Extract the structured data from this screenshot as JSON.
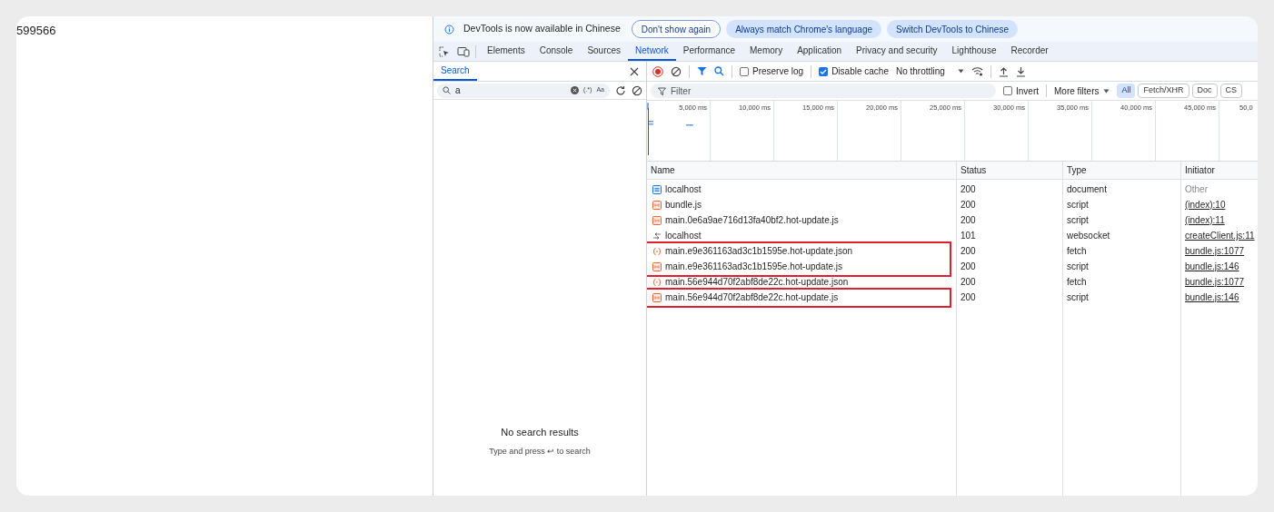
{
  "page_text": "599566",
  "banner": {
    "message": "DevTools is now available in Chinese",
    "buttons": [
      {
        "label": "Don't show again",
        "kind": "outline"
      },
      {
        "label": "Always match Chrome's language",
        "kind": "filled"
      },
      {
        "label": "Switch DevTools to Chinese",
        "kind": "filled"
      }
    ]
  },
  "tabs": [
    {
      "label": "Elements",
      "selected": false
    },
    {
      "label": "Console",
      "selected": false
    },
    {
      "label": "Sources",
      "selected": false
    },
    {
      "label": "Network",
      "selected": true
    },
    {
      "label": "Performance",
      "selected": false
    },
    {
      "label": "Memory",
      "selected": false
    },
    {
      "label": "Application",
      "selected": false
    },
    {
      "label": "Privacy and security",
      "selected": false
    },
    {
      "label": "Lighthouse",
      "selected": false
    },
    {
      "label": "Recorder",
      "selected": false
    }
  ],
  "search_panel": {
    "tab": "Search",
    "query": "a",
    "regex_label": "(.*)",
    "case_label": "Aa",
    "empty_title": "No search results",
    "empty_hint": "Type and press ↩ to search"
  },
  "toolbar": {
    "preserve_log": {
      "label": "Preserve log",
      "checked": false
    },
    "disable_cache": {
      "label": "Disable cache",
      "checked": true
    },
    "throttling": "No throttling"
  },
  "filter_bar": {
    "placeholder": "Filter",
    "invert": {
      "label": "Invert",
      "checked": false
    },
    "more_filters": "More filters",
    "chips": [
      {
        "label": "All",
        "selected": true
      },
      {
        "label": "Fetch/XHR",
        "selected": false
      },
      {
        "label": "Doc",
        "selected": false
      },
      {
        "label": "CS",
        "selected": false
      }
    ]
  },
  "timeline": {
    "ticks": [
      "5,000 ms",
      "10,000 ms",
      "15,000 ms",
      "20,000 ms",
      "25,000 ms",
      "30,000 ms",
      "35,000 ms",
      "40,000 ms",
      "45,000 ms",
      "50,0"
    ]
  },
  "table": {
    "columns": [
      "Name",
      "Status",
      "Type",
      "Initiator"
    ],
    "groups": [
      {
        "highlighted": false,
        "rows": [
          {
            "kind": "document",
            "name": "localhost",
            "status": "200",
            "type": "document",
            "initiator": "Other",
            "link": false
          },
          {
            "kind": "script",
            "name": "bundle.js",
            "status": "200",
            "type": "script",
            "initiator": "(index):10",
            "link": true
          },
          {
            "kind": "script",
            "name": "main.0e6a9ae716d13fa40bf2.hot-update.js",
            "status": "200",
            "type": "script",
            "initiator": "(index):11",
            "link": true
          },
          {
            "kind": "websocket",
            "name": "localhost",
            "status": "101",
            "type": "websocket",
            "initiator": "createClient.js:11",
            "link": true
          }
        ]
      },
      {
        "highlighted": true,
        "rows": [
          {
            "kind": "json",
            "name": "main.e9e361163ad3c1b1595e.hot-update.json",
            "status": "200",
            "type": "fetch",
            "initiator": "bundle.js:1077",
            "link": true
          },
          {
            "kind": "script",
            "name": "main.e9e361163ad3c1b1595e.hot-update.js",
            "status": "200",
            "type": "script",
            "initiator": "bundle.js:146",
            "link": true
          }
        ]
      },
      {
        "highlighted": false,
        "rows": [
          {
            "kind": "json",
            "name": "main.56e944d70f2abf8de22c.hot-update.json",
            "status": "200",
            "type": "fetch",
            "initiator": "bundle.js:1077",
            "link": true
          }
        ]
      },
      {
        "highlighted": true,
        "rows": [
          {
            "kind": "script",
            "name": "main.56e944d70f2abf8de22c.hot-update.js",
            "status": "200",
            "type": "script",
            "initiator": "bundle.js:146",
            "link": true
          }
        ]
      }
    ]
  }
}
